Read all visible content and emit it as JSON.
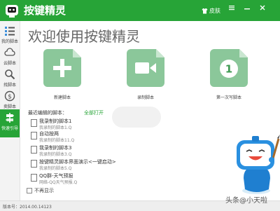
{
  "window": {
    "title": "按键精灵",
    "skin_label": "皮肤",
    "accent": "#27a437"
  },
  "sidebar": {
    "items": [
      {
        "label": "我的脚本",
        "icon": "list-icon"
      },
      {
        "label": "云脚本",
        "icon": "cloud-icon"
      },
      {
        "label": "找脚本",
        "icon": "search-icon"
      },
      {
        "label": "卖脚本",
        "icon": "dollar-icon"
      },
      {
        "label": "快速引导",
        "icon": "signpost-icon"
      }
    ],
    "active_index": 4
  },
  "main": {
    "welcome": "欢迎使用按键精灵",
    "cards": [
      {
        "label": "新建脚本",
        "icon": "plus-icon"
      },
      {
        "label": "录制脚本",
        "icon": "video-camera-icon"
      },
      {
        "label": "第一次写脚本",
        "icon": "number-one-icon",
        "badge": "1"
      }
    ],
    "recent_header": "最近编辑的脚本：",
    "open_all": "全部打开",
    "recent": [
      {
        "name": "我录制的脚本1",
        "path": "我录制的脚本1.Q"
      },
      {
        "name": "自动按两",
        "path": "我录制的脚本11.Q"
      },
      {
        "name": "我录制的脚本3",
        "path": "我录制的脚本3.Q"
      },
      {
        "name": "按键精灵脚本界面演示<一键启动>",
        "path": "我录制的脚本5.Q"
      },
      {
        "name": "QQ群-天气预报",
        "path": "网络-QQ天气预报.Q"
      }
    ],
    "no_show": "不再显示"
  },
  "status": {
    "version": "版本号：2014.00.14123"
  },
  "watermark": "头条@小天啦"
}
